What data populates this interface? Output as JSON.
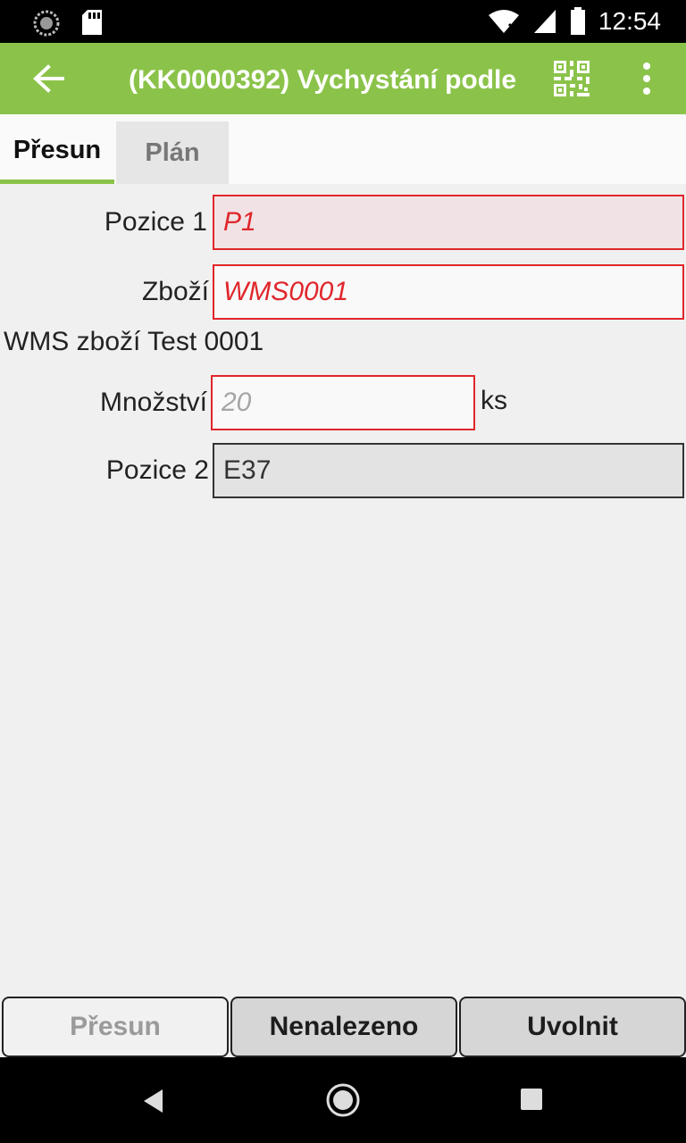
{
  "status_bar": {
    "time": "12:54"
  },
  "app_bar": {
    "title": "(KK0000392) Vychystání podle"
  },
  "tabs": [
    {
      "label": "Přesun",
      "active": true
    },
    {
      "label": "Plán",
      "active": false
    }
  ],
  "form": {
    "pozice1": {
      "label": "Pozice 1",
      "value": "P1"
    },
    "zbozi": {
      "label": "Zboží",
      "value": "WMS0001"
    },
    "zbozi_description": "WMS zboží Test 0001",
    "mnozstvi": {
      "label": "Množství",
      "placeholder": "20",
      "unit": "ks"
    },
    "pozice2": {
      "label": "Pozice 2",
      "value": "E37"
    }
  },
  "buttons": {
    "presun": "Přesun",
    "nenalezeno": "Nenalezeno",
    "uvolnit": "Uvolnit"
  },
  "colors": {
    "accent": "#8bc34a",
    "error": "#e0262b"
  }
}
